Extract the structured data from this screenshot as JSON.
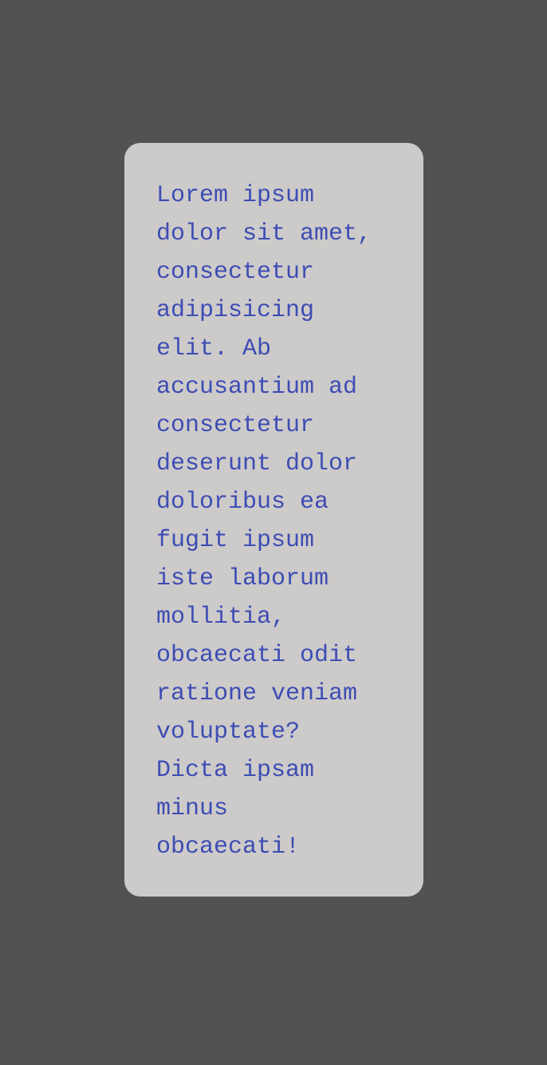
{
  "card": {
    "text": "Lorem ipsum\ndolor sit amet,\nconsectetur\nadipisicing\nelit. Ab\naccusantium ad\nconsectetur\ndeserunt dolor\ndoloribus ea\nfugit ipsum\niste laborum\nmollitia,\nobcaecati odit\nratione veniam\nvoluptate?\nDicta ipsam\nminus\nobcaecati!"
  },
  "colors": {
    "background": "#525252",
    "card_background": "#cdcaca",
    "text": "#3d4db3"
  }
}
